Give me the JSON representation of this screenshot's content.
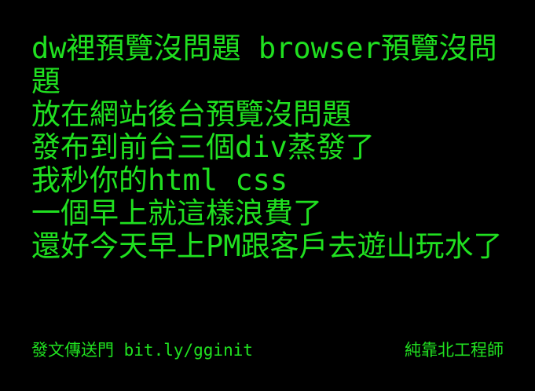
{
  "colors": {
    "background": "#000000",
    "text": "#20e020"
  },
  "poem": {
    "lines": [
      "dw裡預覽沒問題 browser預覽沒問題",
      "放在網站後台預覽沒問題",
      "發布到前台三個div蒸發了",
      "我秒你的html css",
      "一個早上就這樣浪費了",
      "還好今天早上PM跟客戶去遊山玩水了"
    ]
  },
  "footer": {
    "left_text": "發文傳送門 bit.ly/gginit",
    "right_text": "純靠北工程師"
  }
}
